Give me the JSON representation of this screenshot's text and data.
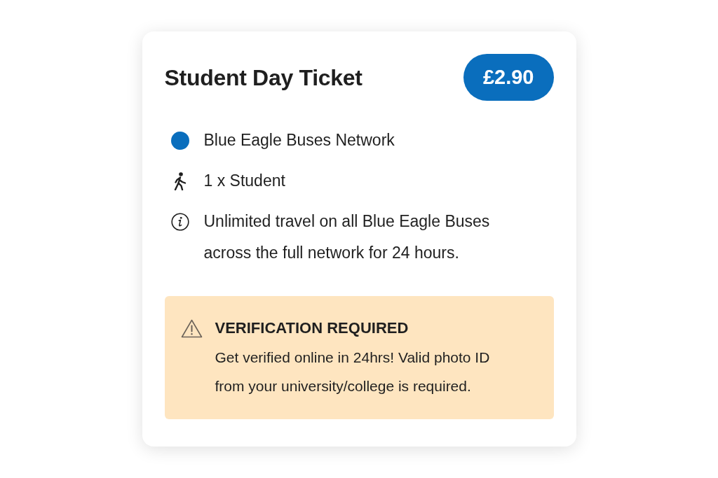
{
  "ticket": {
    "title": "Student Day Ticket",
    "price": "£2.90",
    "details": [
      {
        "kind": "network",
        "text": "Blue Eagle Buses Network",
        "color": "#0a6ebd"
      },
      {
        "kind": "passenger",
        "text": "1 x Student"
      },
      {
        "kind": "info",
        "text": "Unlimited travel on all Blue Eagle Buses across the full network for 24 hours."
      }
    ],
    "notice": {
      "kind": "warning",
      "title": "VERIFICATION REQUIRED",
      "text": "Get verified online in 24hrs! Valid photo ID from your university/college is required."
    }
  }
}
